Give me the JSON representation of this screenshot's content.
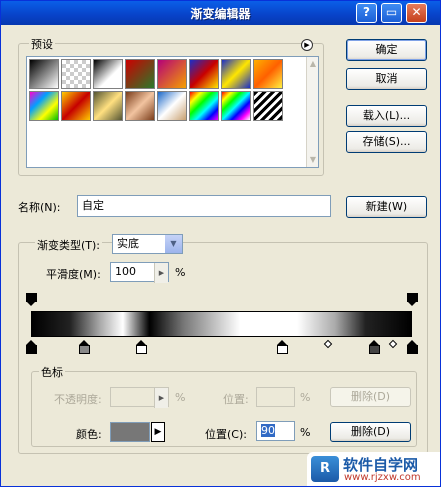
{
  "window": {
    "title": "渐变编辑器",
    "controls": [
      "?",
      "▭",
      "✕"
    ]
  },
  "presets": {
    "label": "预设",
    "menu_icon": "arrow-right-circle-icon",
    "swatches": [
      "linear-gradient(135deg,#000,#fff)",
      "repeating-conic-gradient(#ccc 0 25%,#fff 0 50%) 0 0/8px 8px",
      "linear-gradient(135deg,#000,#fff 60%,transparent)",
      "linear-gradient(135deg,#c00,#2a7a2a)",
      "linear-gradient(135deg,#b40078,#f5a000)",
      "linear-gradient(135deg,#1a2ec8,#c80000,#ffe600)",
      "linear-gradient(135deg,#1a2ec8,#ffe600,#1a2ec8)",
      "linear-gradient(135deg,#ffb000,#ff6000,#fff040)",
      "linear-gradient(135deg,#ff00d0,#00a0ff,#ffff00,#00c000)",
      "linear-gradient(135deg,#ffcc00,#c60000,#ffcc00)",
      "linear-gradient(135deg,#553,#ffe080,#553)",
      "linear-gradient(135deg,#7a3c1a,#f2c4a0,#7a3c1a)",
      "linear-gradient(135deg,#1c68c8,#fff,#c8a070)",
      "linear-gradient(135deg,#f00,#ff0,#0f0,#0ff,#00f,#f0f)",
      "linear-gradient(135deg,#f00,#ff0,#0f0,#0ff,#00f,#f0f,transparent)",
      "repeating-linear-gradient(135deg,#000 0 3px,#fff 3px 6px)"
    ]
  },
  "buttons": {
    "ok": "确定",
    "cancel": "取消",
    "load": "载入(L)...",
    "save": "存储(S)...",
    "new": "新建(W)",
    "delete_opacity": "删除(D)",
    "delete_color": "删除(D)"
  },
  "name": {
    "label": "名称(N):",
    "value": "自定"
  },
  "gradient_type": {
    "label": "渐变类型(T):",
    "value": "实底"
  },
  "smoothness": {
    "label": "平滑度(M):",
    "value": "100",
    "unit": "%"
  },
  "gradient": {
    "bar": "linear-gradient(to right,#000 0%,#222 10%,#aaa 18%,#fff 24%,#000 31%,#777 40%,#fff 55%,#fff 70%,#aaa 80%,#222 88%,#000 100%)",
    "color_stops": [
      {
        "pos": 0,
        "fill": "#000"
      },
      {
        "pos": 14,
        "fill": "#888"
      },
      {
        "pos": 29,
        "fill": "#fff"
      },
      {
        "pos": 66,
        "fill": "#fff"
      },
      {
        "pos": 90,
        "fill": "#444"
      },
      {
        "pos": 100,
        "fill": "#000"
      }
    ],
    "opacity_stops": [
      0,
      100
    ],
    "midpoints": [
      78,
      95
    ]
  },
  "stops_group": {
    "label": "色标",
    "opacity_label": "不透明度:",
    "opacity_unit": "%",
    "opacity_position_label": "位置:",
    "opacity_position_unit": "%",
    "color_label": "颜色:",
    "color_value": "#777777",
    "color_position_label": "位置(C):",
    "color_position_value": "90",
    "color_position_unit": "%"
  },
  "watermark": {
    "logo": "R",
    "title": "软件自学网",
    "url": "www.rjzxw.com"
  }
}
